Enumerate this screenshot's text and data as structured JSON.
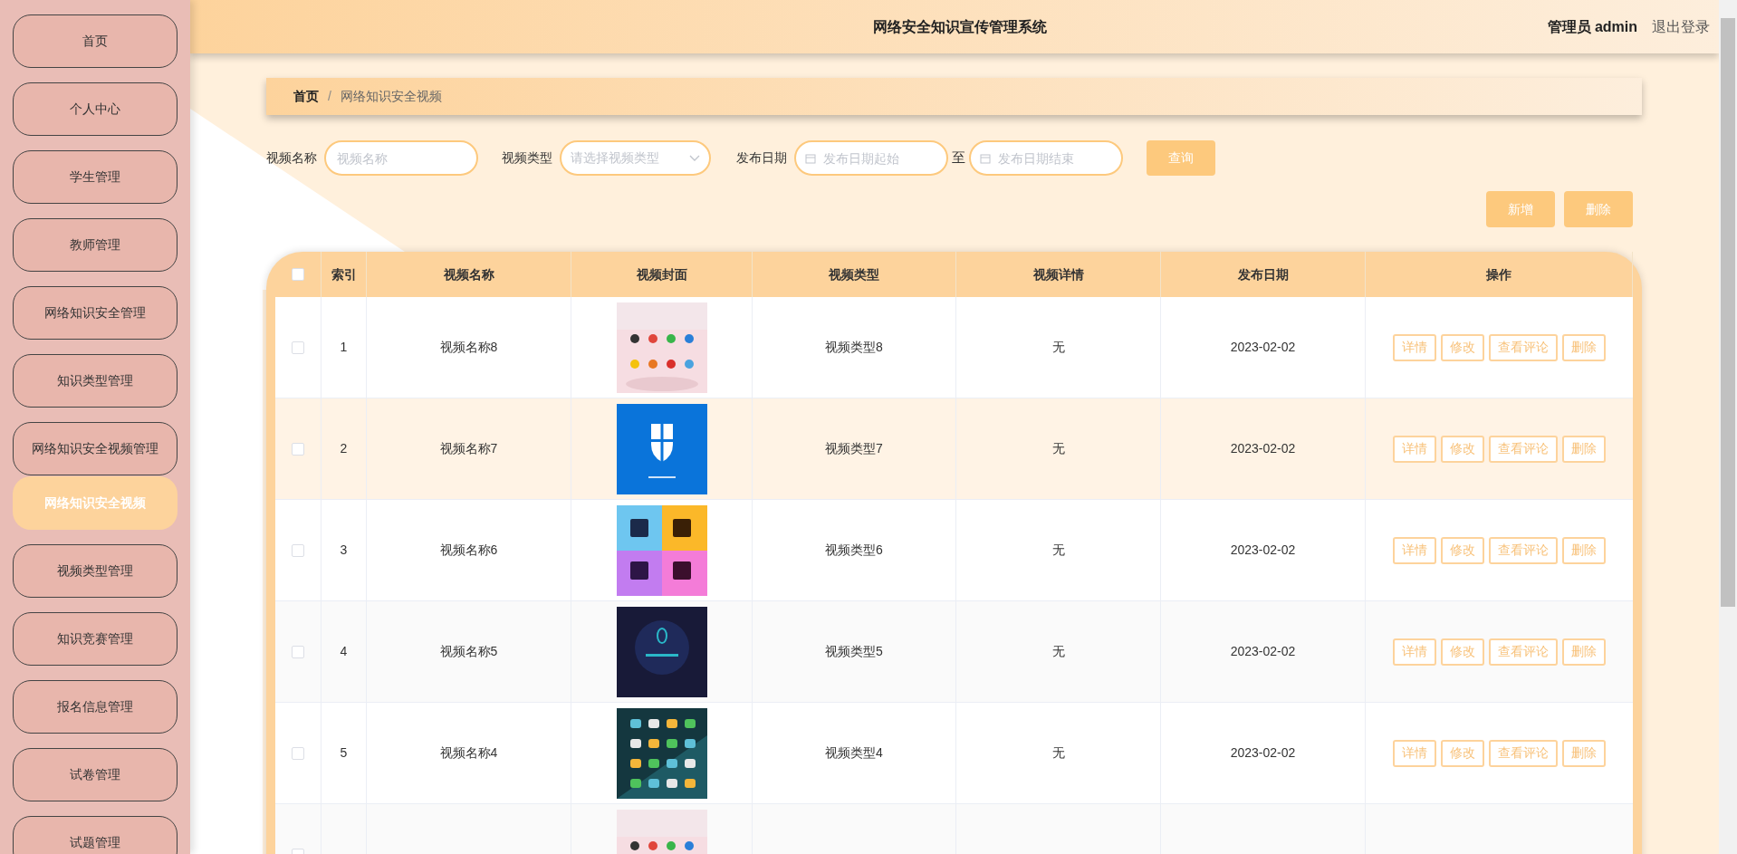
{
  "header": {
    "title": "网络安全知识宣传管理系统",
    "user_role": "管理员",
    "user_name": "admin",
    "logout": "退出登录"
  },
  "sidebar": {
    "items": [
      {
        "label": "首页",
        "selected": false
      },
      {
        "label": "个人中心",
        "selected": false
      },
      {
        "label": "学生管理",
        "selected": false
      },
      {
        "label": "教师管理",
        "selected": false
      },
      {
        "label": "网络知识安全管理",
        "selected": false
      },
      {
        "label": "知识类型管理",
        "selected": false
      },
      {
        "label": "网络知识安全视频管理",
        "selected": false
      },
      {
        "label": "网络知识安全视频",
        "selected": true
      },
      {
        "label": "视频类型管理",
        "selected": false
      },
      {
        "label": "知识竞赛管理",
        "selected": false
      },
      {
        "label": "报名信息管理",
        "selected": false
      },
      {
        "label": "试卷管理",
        "selected": false
      },
      {
        "label": "试题管理",
        "selected": false
      }
    ]
  },
  "breadcrumb": {
    "home": "首页",
    "separator": "/",
    "current": "网络知识安全视频"
  },
  "filters": {
    "name_label": "视频名称",
    "name_placeholder": "视频名称",
    "type_label": "视频类型",
    "type_placeholder": "请选择视频类型",
    "date_label": "发布日期",
    "date_start_placeholder": "发布日期起始",
    "date_to": "至",
    "date_end_placeholder": "发布日期结束",
    "search_button": "查询"
  },
  "toolbar": {
    "add_button": "新增",
    "delete_button": "删除"
  },
  "table": {
    "columns": [
      "索引",
      "视频名称",
      "视频封面",
      "视频类型",
      "视频详情",
      "发布日期",
      "操作"
    ],
    "header_checked": false,
    "rows": [
      {
        "index": "1",
        "name": "视频名称8",
        "type": "视频类型8",
        "detail": "无",
        "date": "2023-02-02",
        "checked": false,
        "actions": [
          "详情",
          "修改",
          "查看评论",
          "删除"
        ]
      },
      {
        "index": "2",
        "name": "视频名称7",
        "type": "视频类型7",
        "detail": "无",
        "date": "2023-02-02",
        "checked": false,
        "actions": [
          "详情",
          "修改",
          "查看评论",
          "删除"
        ]
      },
      {
        "index": "3",
        "name": "视频名称6",
        "type": "视频类型6",
        "detail": "无",
        "date": "2023-02-02",
        "checked": false,
        "actions": [
          "详情",
          "修改",
          "查看评论",
          "删除"
        ]
      },
      {
        "index": "4",
        "name": "视频名称5",
        "type": "视频类型5",
        "detail": "无",
        "date": "2023-02-02",
        "checked": false,
        "actions": [
          "详情",
          "修改",
          "查看评论",
          "删除"
        ]
      },
      {
        "index": "5",
        "name": "视频名称4",
        "type": "视频类型4",
        "detail": "无",
        "date": "2023-02-02",
        "checked": false,
        "actions": [
          "详情",
          "修改",
          "查看评论",
          "删除"
        ]
      },
      {
        "checked": false
      }
    ]
  }
}
